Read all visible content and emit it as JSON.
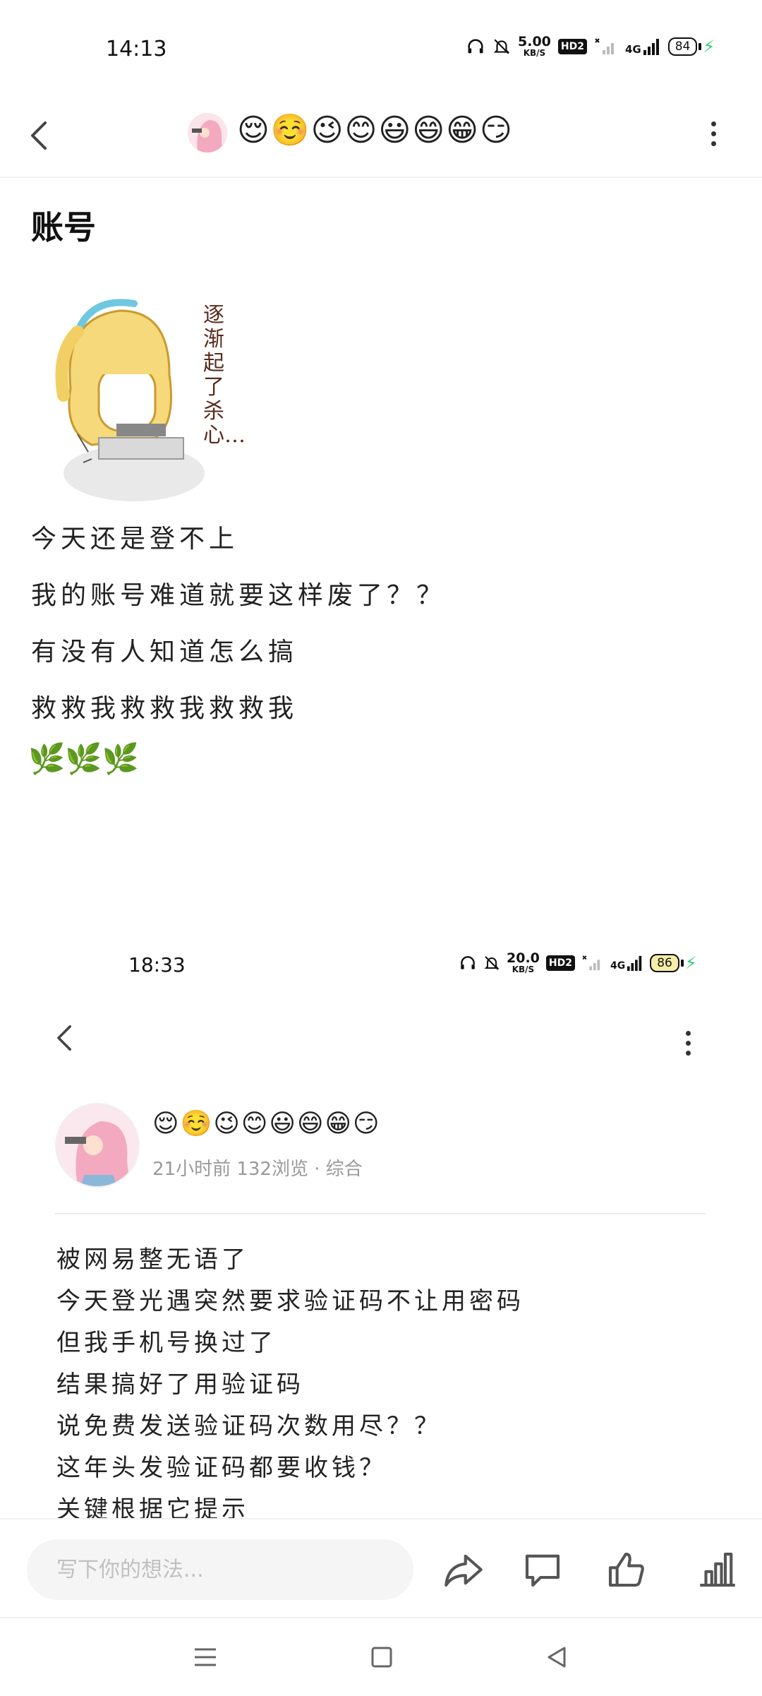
{
  "status_bar_1": {
    "time": "14:13",
    "speed_value": "5.00",
    "speed_unit": "KB/S",
    "hd": "HD2",
    "network": "4G",
    "battery": "84"
  },
  "header": {
    "emoji_title": "😌☺️😉😊😃😄😁😏"
  },
  "post1": {
    "title": "账号",
    "sticker_text": "逐渐起了杀心…",
    "lines": [
      "今天还是登不上",
      "我的账号难道就要这样废了？？",
      "有没有人知道怎么搞",
      "救救我救救我救救我"
    ],
    "leaves": "🌿🌿🌿"
  },
  "status_bar_2": {
    "time": "18:33",
    "speed_value": "20.0",
    "speed_unit": "KB/S",
    "hd": "HD2",
    "network": "4G",
    "battery": "86"
  },
  "post2": {
    "author_emojis": "😌☺️😉😊😃😄😁😏",
    "meta": "21小时前  132浏览 · 综合",
    "lines": [
      "被网易整无语了",
      "今天登光遇突然要求验证码不让用密码",
      "但我手机号换过了",
      "结果搞好了用验证码",
      "说免费发送验证码次数用尽？？",
      "这年头发验证码都要收钱？",
      "关键根据它提示"
    ]
  },
  "action_bar": {
    "comment_placeholder": "写下你的想法..."
  },
  "icons": {
    "back": "chevron-left-icon",
    "more": "more-vertical-icon",
    "share": "share-icon",
    "comment": "comment-icon",
    "like": "thumbs-up-icon",
    "stats": "bar-chart-icon",
    "nav_menu": "menu-icon",
    "nav_home": "home-square-icon",
    "nav_back": "back-triangle-icon"
  },
  "colors": {
    "charging": "#2ecc71",
    "meta_text": "#9a9a9a",
    "input_bg": "#f5f5f5"
  }
}
